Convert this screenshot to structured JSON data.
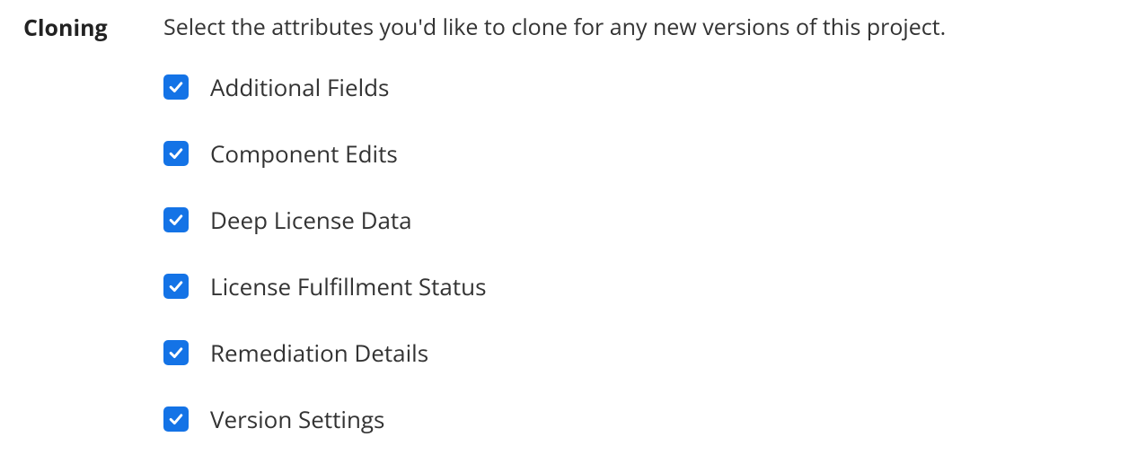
{
  "section": {
    "title": "Cloning",
    "description": "Select the attributes you'd like to clone for any new versions of this project."
  },
  "options": [
    {
      "label": "Additional Fields",
      "checked": true
    },
    {
      "label": "Component Edits",
      "checked": true
    },
    {
      "label": "Deep License Data",
      "checked": true
    },
    {
      "label": "License Fulfillment Status",
      "checked": true
    },
    {
      "label": "Remediation Details",
      "checked": true
    },
    {
      "label": "Version Settings",
      "checked": true
    }
  ],
  "colors": {
    "checkbox": "#1473e6"
  }
}
